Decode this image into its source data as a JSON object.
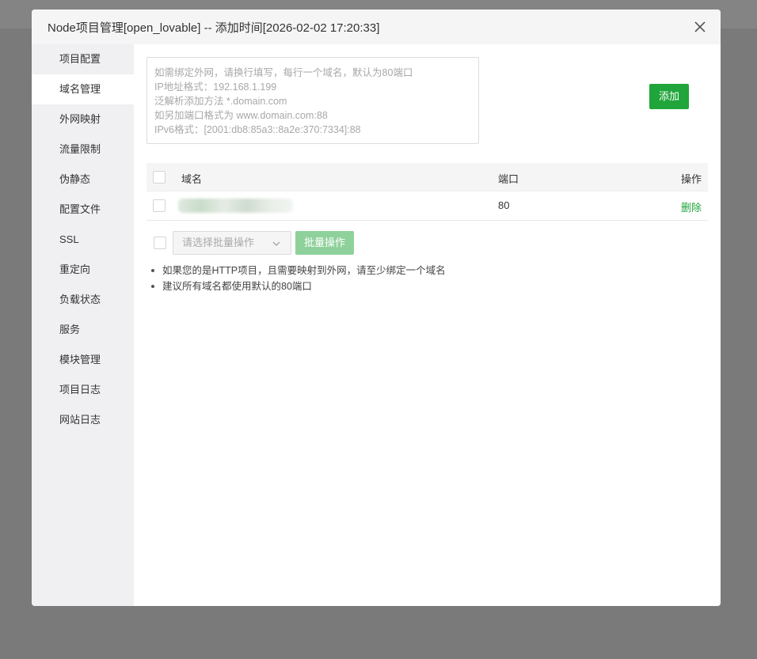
{
  "window": {
    "title": "Node项目管理[open_lovable] -- 添加时间[2026-02-02 17:20:33]"
  },
  "sidebar": {
    "items": [
      {
        "label": "项目配置"
      },
      {
        "label": "域名管理",
        "active": true
      },
      {
        "label": "外网映射"
      },
      {
        "label": "流量限制"
      },
      {
        "label": "伪静态"
      },
      {
        "label": "配置文件"
      },
      {
        "label": "SSL"
      },
      {
        "label": "重定向"
      },
      {
        "label": "负载状态"
      },
      {
        "label": "服务"
      },
      {
        "label": "模块管理"
      },
      {
        "label": "项目日志"
      },
      {
        "label": "网站日志"
      }
    ]
  },
  "domain_input": {
    "placeholder_lines": [
      "如需绑定外网，请换行填写，每行一个域名，默认为80端口",
      "IP地址格式：192.168.1.199",
      "泛解析添加方法 *.domain.com",
      "如另加端口格式为 www.domain.com:88",
      "IPv6格式：[2001:db8:85a3::8a2e:370:7334]:88"
    ],
    "add_button": "添加"
  },
  "table": {
    "headers": {
      "domain": "域名",
      "port": "端口",
      "op": "操作"
    },
    "rows": [
      {
        "port": "80",
        "op": "删除"
      }
    ]
  },
  "batch": {
    "select_placeholder": "请选择批量操作",
    "button": "批量操作"
  },
  "tips": [
    "如果您的是HTTP项目，且需要映射到外网，请至少绑定一个域名",
    "建议所有域名都使用默认的80端口"
  ],
  "colors": {
    "accent": "#20a53a",
    "accent_disabled": "#8fd19b"
  }
}
